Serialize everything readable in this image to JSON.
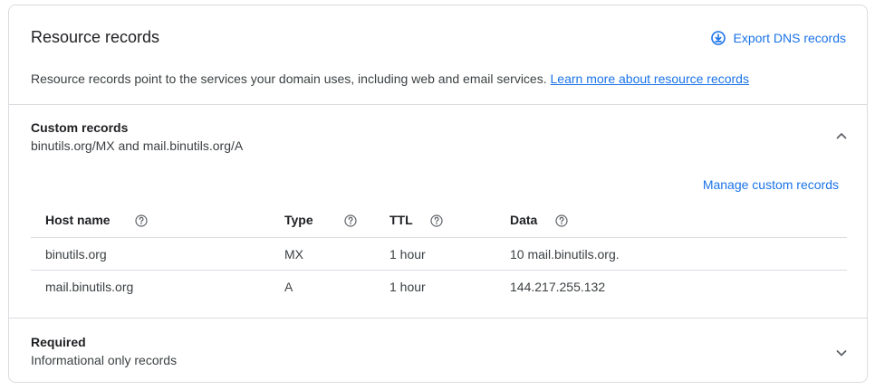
{
  "header": {
    "title": "Resource records",
    "export_label": "Export DNS records",
    "description": "Resource records point to the services your domain uses, including web and email services.",
    "learn_more_link": "Learn more about resource records"
  },
  "custom_records": {
    "title": "Custom records",
    "subtitle": "binutils.org/MX and mail.binutils.org/A",
    "expanded": true,
    "manage_label": "Manage custom records",
    "columns": [
      "Host name",
      "Type",
      "TTL",
      "Data"
    ],
    "rows": [
      {
        "host": "binutils.org",
        "type": "MX",
        "ttl": "1 hour",
        "data": "10 mail.binutils.org."
      },
      {
        "host": "mail.binutils.org",
        "type": "A",
        "ttl": "1 hour",
        "data": "144.217.255.132"
      }
    ]
  },
  "required": {
    "title": "Required",
    "subtitle": "Informational only records",
    "expanded": false
  },
  "icons": {
    "export": "download-circle-icon",
    "help": "help-circle-icon",
    "collapse": "chevron-up-icon",
    "expand": "chevron-down-icon"
  },
  "colors": {
    "accent": "#1a73e8",
    "border": "#dadce0",
    "text": "#202124",
    "secondary_text": "#3c4043"
  }
}
